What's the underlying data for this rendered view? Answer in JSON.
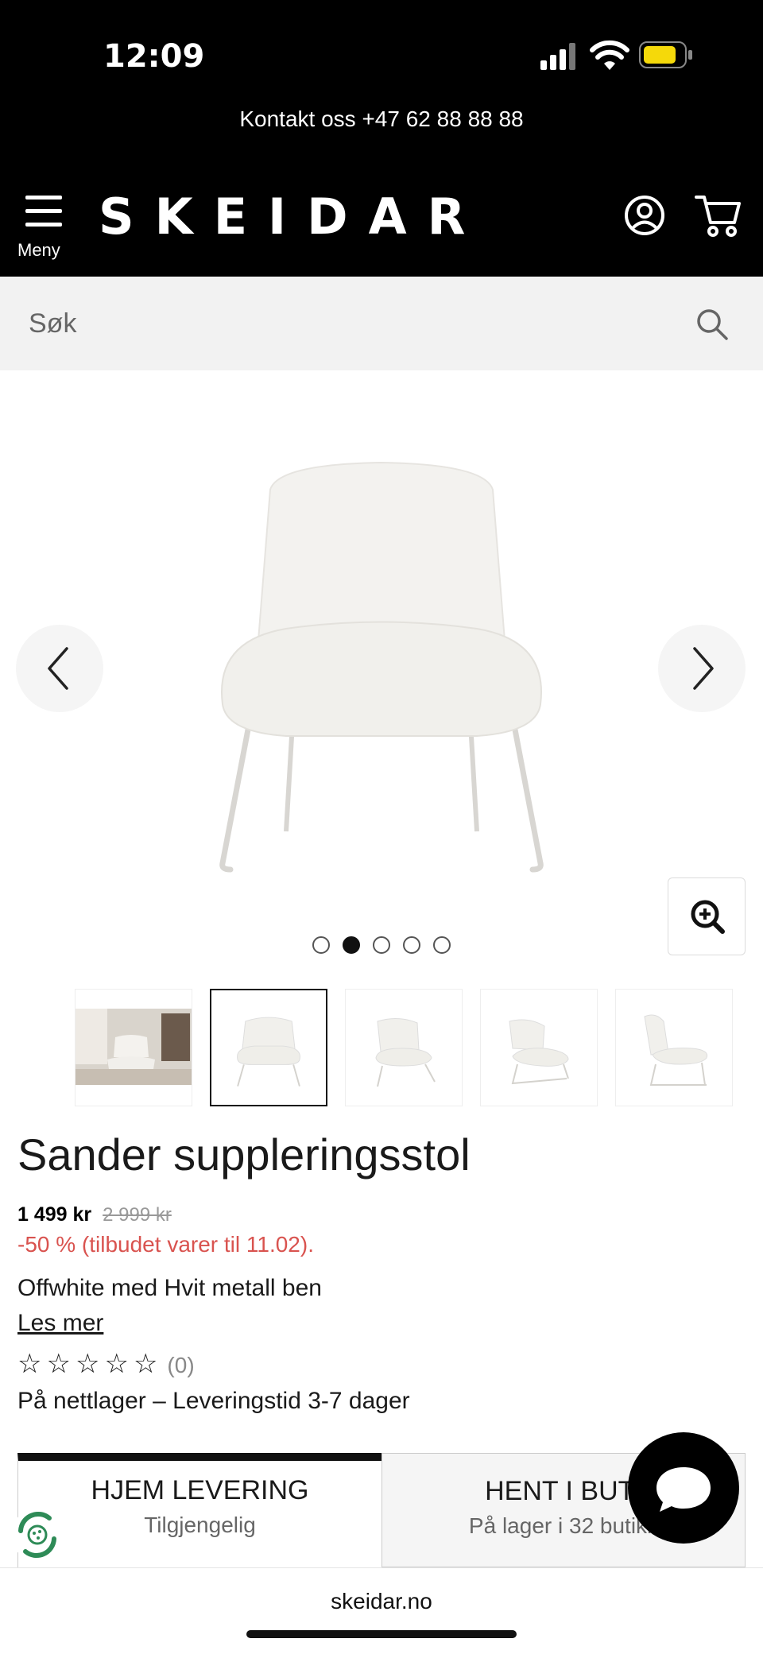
{
  "status_bar": {
    "time": "12:09"
  },
  "header": {
    "contact": "Kontakt oss +47 62 88 88 88",
    "menu_label": "Meny",
    "logo": "SKEIDAR"
  },
  "search": {
    "placeholder": "Søk"
  },
  "gallery": {
    "image_count": 5,
    "active_index": 1,
    "thumbnails": [
      "room-scene",
      "chair-front",
      "chair-angle",
      "chair-side-angle",
      "chair-side"
    ]
  },
  "product": {
    "title": "Sander suppleringsstol",
    "price": "1 499 kr",
    "old_price": "2 999 kr",
    "discount": "-50 % (tilbudet varer til 11.02).",
    "variant": "Offwhite med Hvit metall ben",
    "read_more": "Les mer",
    "rating": {
      "stars": 0,
      "max": 5,
      "count_label": "(0)"
    },
    "stock": "På nettlager – Leveringstid 3-7 dager"
  },
  "delivery": {
    "home": {
      "title": "HJEM LEVERING",
      "subtitle": "Tilgjengelig"
    },
    "store": {
      "title": "HENT I BUTI",
      "subtitle": "På lager i 32 butikk"
    }
  },
  "browser": {
    "url": "skeidar.no"
  },
  "colors": {
    "header_bg": "#000000",
    "discount": "#d9534f",
    "search_bg": "#f2f2f2"
  }
}
